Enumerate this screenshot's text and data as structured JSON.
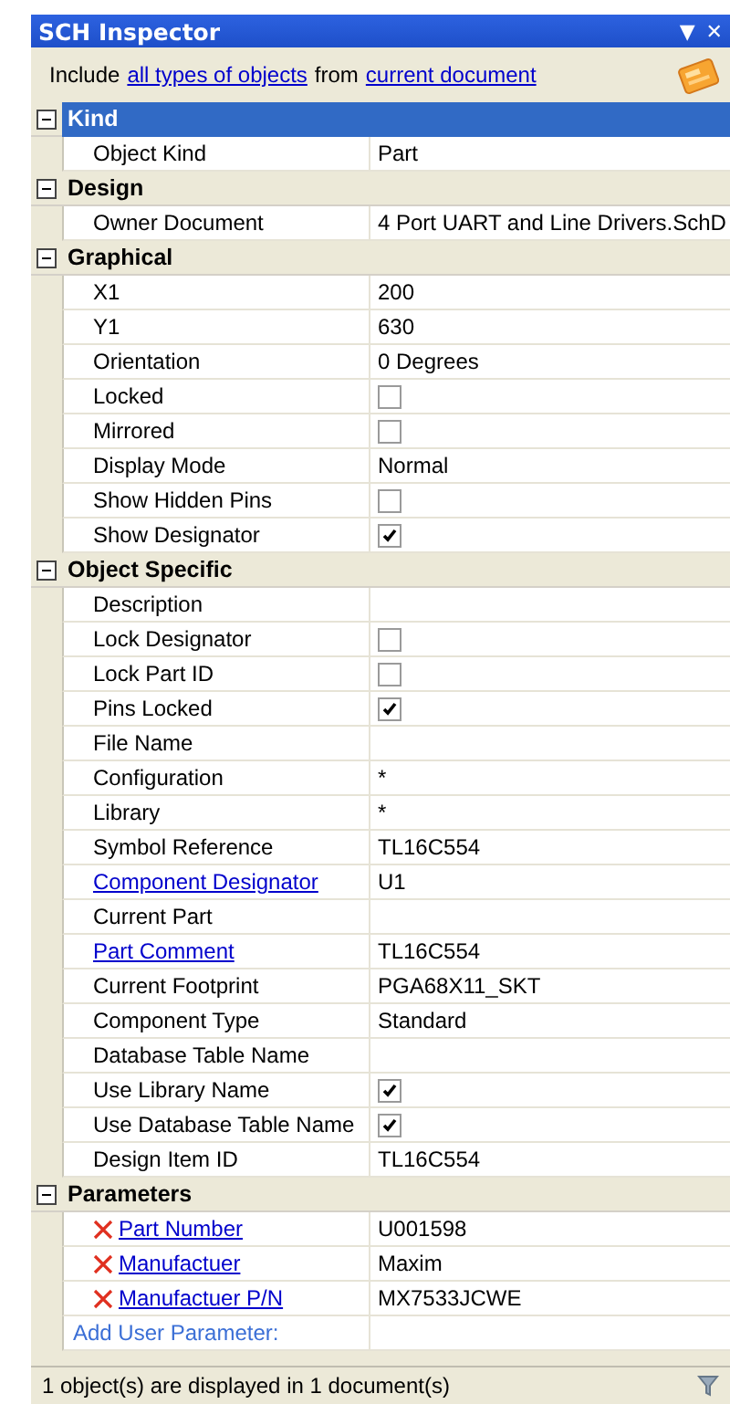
{
  "window": {
    "title": "SCH Inspector",
    "menu_glyph": "▼",
    "close_glyph": "✕"
  },
  "filter": {
    "prefix": "Include",
    "scope_link": "all types of objects",
    "middle": "from",
    "source_link": "current document"
  },
  "sections": [
    {
      "title": "Kind",
      "expanded": true,
      "selected": true,
      "rows": [
        {
          "kind": "text",
          "name": "Object Kind",
          "value": "Part"
        }
      ]
    },
    {
      "title": "Design",
      "expanded": true,
      "selected": false,
      "rows": [
        {
          "kind": "text",
          "name": "Owner Document",
          "value": "4 Port UART and Line Drivers.SchD"
        }
      ]
    },
    {
      "title": "Graphical",
      "expanded": true,
      "selected": false,
      "rows": [
        {
          "kind": "text",
          "name": "X1",
          "value": "200"
        },
        {
          "kind": "text",
          "name": "Y1",
          "value": "630"
        },
        {
          "kind": "text",
          "name": "Orientation",
          "value": "0 Degrees"
        },
        {
          "kind": "check",
          "name": "Locked",
          "checked": false
        },
        {
          "kind": "check",
          "name": "Mirrored",
          "checked": false
        },
        {
          "kind": "text",
          "name": "Display Mode",
          "value": "Normal"
        },
        {
          "kind": "check",
          "name": "Show Hidden Pins",
          "checked": false
        },
        {
          "kind": "check",
          "name": "Show Designator",
          "checked": true
        }
      ]
    },
    {
      "title": "Object Specific",
      "expanded": true,
      "selected": false,
      "rows": [
        {
          "kind": "text",
          "name": "Description"
        },
        {
          "kind": "check",
          "name": "Lock Designator",
          "checked": false
        },
        {
          "kind": "check",
          "name": "Lock Part ID",
          "checked": false
        },
        {
          "kind": "check",
          "name": "Pins Locked",
          "checked": true
        },
        {
          "kind": "text",
          "name": "File Name"
        },
        {
          "kind": "text",
          "name": "Configuration",
          "value": "*"
        },
        {
          "kind": "text",
          "name": "Library",
          "value": "*"
        },
        {
          "kind": "text",
          "name": "Symbol Reference",
          "value": "TL16C554"
        },
        {
          "kind": "link",
          "name": "Component Designator",
          "value": "U1"
        },
        {
          "kind": "text",
          "name": "Current Part"
        },
        {
          "kind": "link",
          "name": "Part Comment",
          "value": "TL16C554"
        },
        {
          "kind": "text",
          "name": "Current Footprint",
          "value": "PGA68X11_SKT"
        },
        {
          "kind": "text",
          "name": "Component Type",
          "value": "Standard"
        },
        {
          "kind": "text",
          "name": "Database Table Name"
        },
        {
          "kind": "check",
          "name": "Use Library Name",
          "checked": true
        },
        {
          "kind": "check",
          "name": "Use Database Table Name",
          "checked": true
        },
        {
          "kind": "text",
          "name": "Design Item ID",
          "value": "TL16C554"
        }
      ]
    },
    {
      "title": "Parameters",
      "expanded": true,
      "selected": false,
      "rows": [
        {
          "kind": "param",
          "name": "Part Number",
          "value": "U001598"
        },
        {
          "kind": "param",
          "name": "Manufactuer",
          "value": "Maxim"
        },
        {
          "kind": "param",
          "name": "Manufactuer P/N",
          "value": "MX7533JCWE"
        },
        {
          "kind": "add",
          "name": "Add User Parameter:"
        }
      ]
    }
  ],
  "status_bar": {
    "text": "1 object(s) are displayed in 1 document(s)"
  }
}
